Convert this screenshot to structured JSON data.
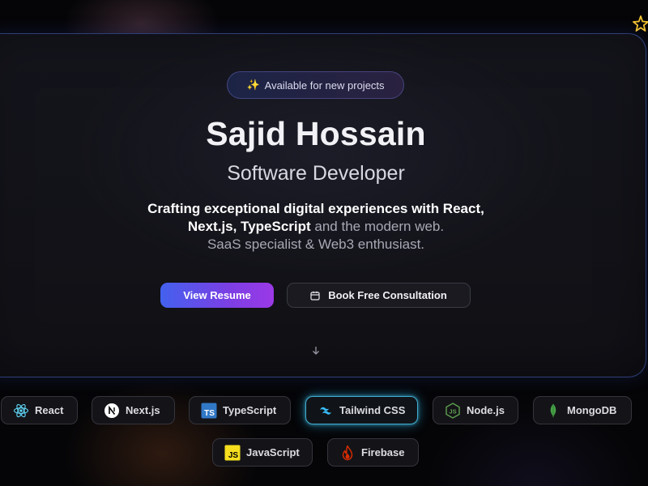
{
  "badge": {
    "icon": "sparkles-icon",
    "icon_glyph": "✨",
    "label": "Available for new projects"
  },
  "hero": {
    "name": "Sajid Hossain",
    "role": "Software Developer",
    "tagline": {
      "line1_strong": "Crafting exceptional digital experiences with React,",
      "line2_strong": "Next.js, TypeScript",
      "line2_rest": " and the modern web.",
      "line3": "SaaS specialist & Web3 enthusiast."
    }
  },
  "actions": {
    "primary_label": "View Resume",
    "secondary_label": "Book Free Consultation",
    "secondary_icon": "calendar-icon"
  },
  "scroll": {
    "icon": "arrow-down-icon"
  },
  "decor": {
    "corner_icon": "star-icon"
  },
  "tech_stack": [
    {
      "label": "React",
      "icon": "react-icon",
      "color": "#61dafb"
    },
    {
      "label": "Next.js",
      "icon": "nextjs-icon",
      "color": "#ffffff"
    },
    {
      "label": "TypeScript",
      "icon": "typescript-icon",
      "color": "#3178c6"
    },
    {
      "label": "Tailwind CSS",
      "icon": "tailwind-icon",
      "color": "#38bdf8",
      "active": true
    },
    {
      "label": "Node.js",
      "icon": "nodejs-icon",
      "color": "#5fa04e"
    },
    {
      "label": "MongoDB",
      "icon": "mongodb-icon",
      "color": "#47a248"
    },
    {
      "label": "JavaScript",
      "icon": "javascript-icon",
      "color": "#f7df1e"
    },
    {
      "label": "Firebase",
      "icon": "firebase-icon",
      "color": "#dd2c00"
    }
  ],
  "colors": {
    "accent_start": "#4361ee",
    "accent_end": "#9b39e6",
    "background": "#050507",
    "card": "#121218"
  }
}
